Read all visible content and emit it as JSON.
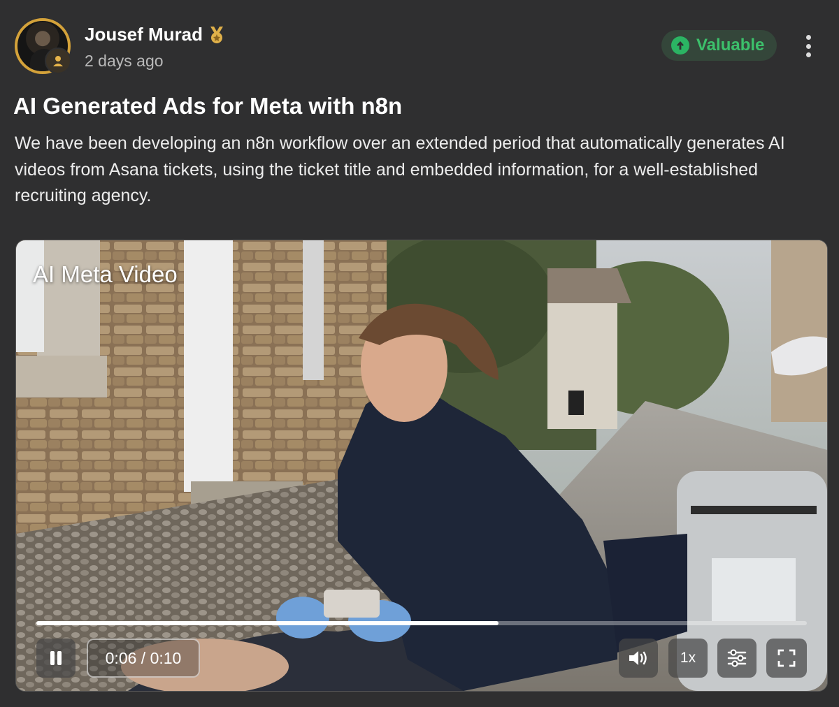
{
  "post": {
    "author": "Jousef Murad",
    "timestamp": "2 days ago",
    "badge_label": "Valuable",
    "title": "AI Generated Ads for Meta with n8n",
    "body": "We have been developing an n8n workflow over an extended period that automatically generates AI videos from Asana tickets, using the ticket title and embedded information, for a well-established recruiting agency."
  },
  "video": {
    "title": "AI Meta Video",
    "time_display": "0:06 / 0:10",
    "progress_fraction": 0.6,
    "speed_label": "1x"
  },
  "icons": {
    "author_level": "medal-icon",
    "avatar_badge": "user-icon",
    "badge": "arrow-up-icon",
    "menu": "more-vertical-icon",
    "play": "pause-icon",
    "volume": "volume-icon",
    "settings": "sliders-icon",
    "fullscreen": "fullscreen-icon"
  },
  "colors": {
    "background": "#2f2f30",
    "accent_gold": "#d4a23a",
    "valuable_green": "#3cc06b"
  }
}
